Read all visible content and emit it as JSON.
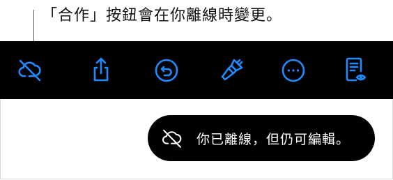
{
  "callout": {
    "text": "「合作」按鈕會在你離線時變更。"
  },
  "toolbar": {
    "accent_color": "#1f8bff",
    "items": [
      {
        "icon": "cloud-offline-icon"
      },
      {
        "icon": "share-icon"
      },
      {
        "icon": "undo-icon"
      },
      {
        "icon": "format-brush-icon"
      },
      {
        "icon": "more-icon"
      },
      {
        "icon": "reading-view-icon"
      }
    ]
  },
  "toast": {
    "icon": "cloud-offline-icon",
    "message": "你已離線，但仍可編輯。"
  }
}
